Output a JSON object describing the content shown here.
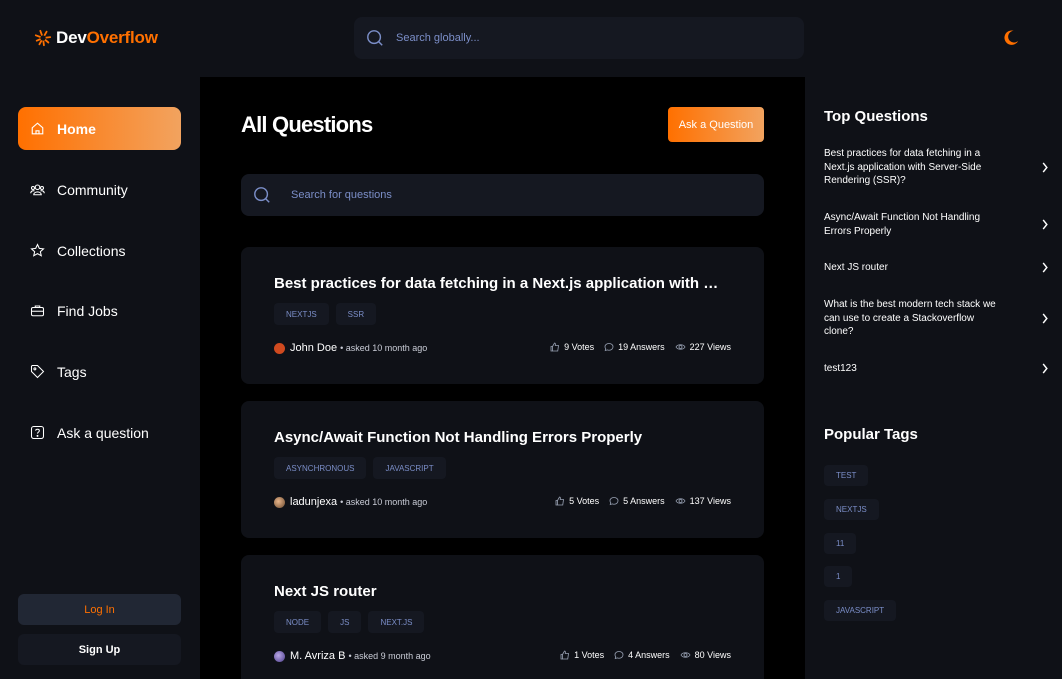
{
  "brand": {
    "name_part1": "Dev",
    "name_part2": "Overflow",
    "accent": "#ff7000"
  },
  "header": {
    "search_placeholder": "Search globally...",
    "theme_icon": "moon-icon"
  },
  "sidebar": {
    "items": [
      {
        "label": "Home",
        "icon": "home-icon",
        "active": true
      },
      {
        "label": "Community",
        "icon": "users-icon"
      },
      {
        "label": "Collections",
        "icon": "star-icon"
      },
      {
        "label": "Find Jobs",
        "icon": "briefcase-icon"
      },
      {
        "label": "Tags",
        "icon": "tag-icon"
      },
      {
        "label": "Ask a question",
        "icon": "question-icon"
      }
    ],
    "login_label": "Log In",
    "signup_label": "Sign Up"
  },
  "main": {
    "title": "All Questions",
    "ask_button": "Ask a Question",
    "search_placeholder": "Search for questions",
    "questions": [
      {
        "title": "Best practices for data fetching in a Next.js application with Server-Side Rendering (SSR)?",
        "tags": [
          "NEXTJS",
          "SSR"
        ],
        "author": "John Doe",
        "asked": "• asked 10 month ago",
        "votes": "9 Votes",
        "answers": "19 Answers",
        "views": "227 Views"
      },
      {
        "title": "Async/Await Function Not Handling Errors Properly",
        "tags": [
          "ASYNCHRONOUS",
          "JAVASCRIPT"
        ],
        "author": "ladunjexa",
        "asked": "• asked 10 month ago",
        "votes": "5 Votes",
        "answers": "5 Answers",
        "views": "137 Views"
      },
      {
        "title": "Next JS router",
        "tags": [
          "NODE",
          "JS",
          "NEXT.JS"
        ],
        "author": "M. Avriza B",
        "asked": "• asked 9 month ago",
        "votes": "1 Votes",
        "answers": "4 Answers",
        "views": "80 Views"
      }
    ]
  },
  "rightbar": {
    "top_questions_title": "Top Questions",
    "top_questions": [
      "Best practices for data fetching in a Next.js application with Server-Side Rendering (SSR)?",
      "Async/Await Function Not Handling Errors Properly",
      "Next JS router",
      "What is the best modern tech stack we can use to create a Stackoverflow clone?",
      "test123"
    ],
    "popular_tags_title": "Popular Tags",
    "popular_tags": [
      "TEST",
      "NEXTJS",
      "11",
      "1",
      "JAVASCRIPT"
    ]
  }
}
